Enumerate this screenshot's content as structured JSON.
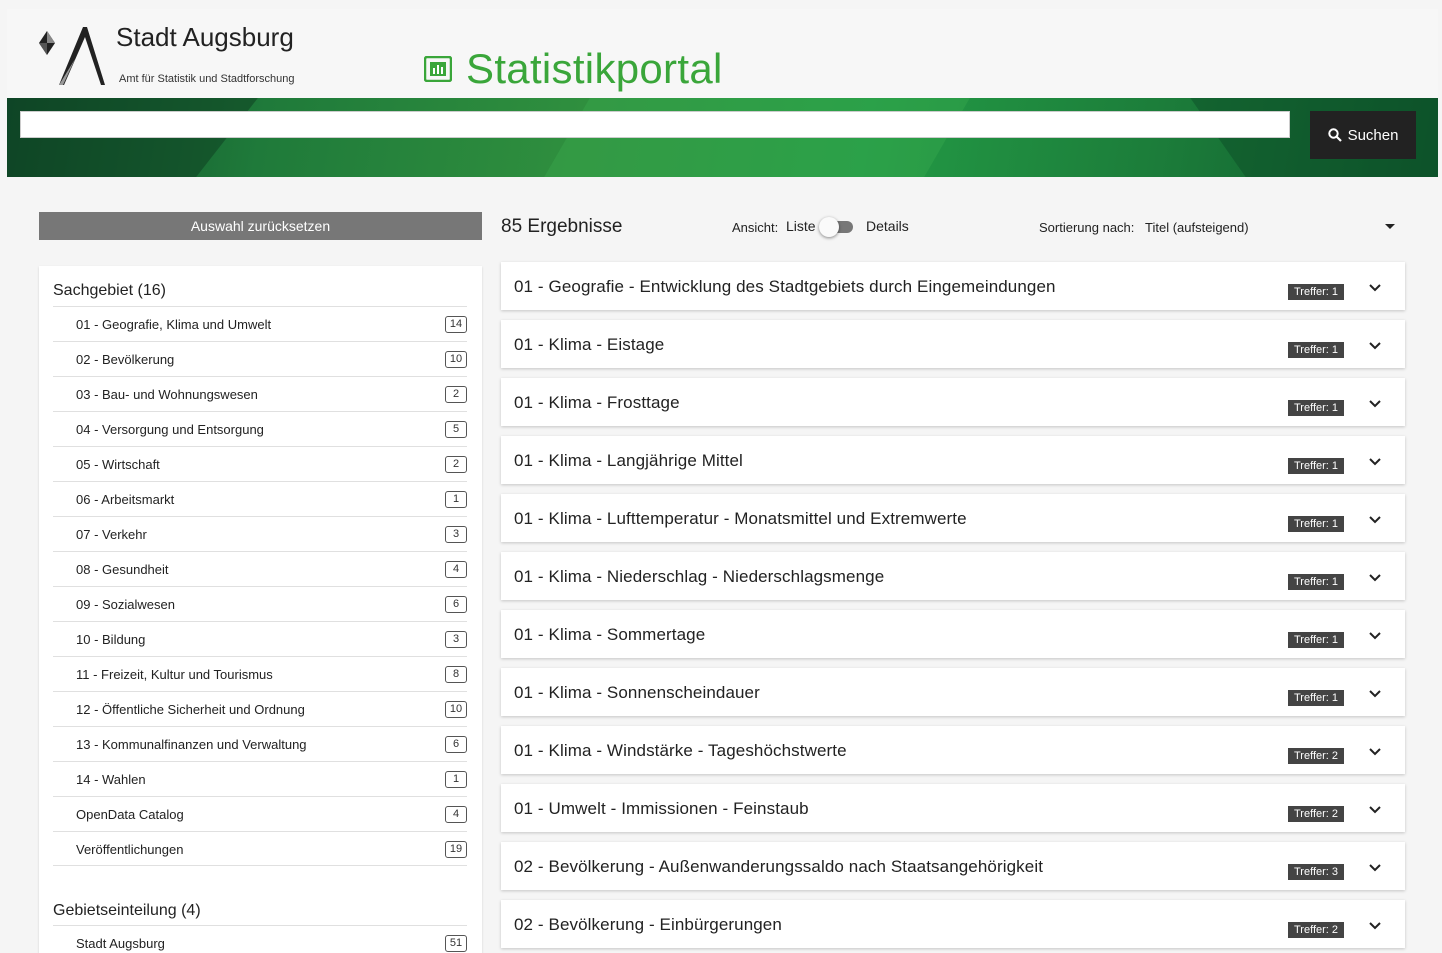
{
  "header": {
    "city_name": "Stadt Augsburg",
    "city_sub": "Amt für Statistik und Stadtforschung",
    "portal_title": "Statistikportal"
  },
  "search": {
    "value": "",
    "placeholder": "",
    "button_label": "Suchen"
  },
  "sidebar": {
    "reset_label": "Auswahl zurücksetzen",
    "groups": [
      {
        "title": "Sachgebiet (16)",
        "items": [
          {
            "label": "01 - Geografie, Klima und Umwelt",
            "count": "14"
          },
          {
            "label": "02 - Bevölkerung",
            "count": "10"
          },
          {
            "label": "03 - Bau- und Wohnungswesen",
            "count": "2"
          },
          {
            "label": "04 - Versorgung und Entsorgung",
            "count": "5"
          },
          {
            "label": "05 - Wirtschaft",
            "count": "2"
          },
          {
            "label": "06 - Arbeitsmarkt",
            "count": "1"
          },
          {
            "label": "07 - Verkehr",
            "count": "3"
          },
          {
            "label": "08 - Gesundheit",
            "count": "4"
          },
          {
            "label": "09 - Sozialwesen",
            "count": "6"
          },
          {
            "label": "10 - Bildung",
            "count": "3"
          },
          {
            "label": "11 - Freizeit, Kultur und Tourismus",
            "count": "8"
          },
          {
            "label": "12 - Öffentliche Sicherheit und Ordnung",
            "count": "10"
          },
          {
            "label": "13 - Kommunalfinanzen und Verwaltung",
            "count": "6"
          },
          {
            "label": "14 - Wahlen",
            "count": "1"
          },
          {
            "label": "OpenData Catalog",
            "count": "4"
          },
          {
            "label": "Veröffentlichungen",
            "count": "19"
          }
        ]
      },
      {
        "title": "Gebietseinteilung (4)",
        "items": [
          {
            "label": "Stadt Augsburg",
            "count": "51"
          }
        ]
      }
    ]
  },
  "results_header": {
    "count_label": "85 Ergebnisse",
    "view_label": "Ansicht:",
    "view_list": "Liste",
    "view_details": "Details",
    "sort_label": "Sortierung nach:",
    "sort_value": "Titel (aufsteigend)"
  },
  "results": [
    {
      "title": "01 - Geografie - Entwicklung des Stadtgebiets durch Eingemeindungen",
      "badge": "Treffer: 1"
    },
    {
      "title": "01 - Klima - Eistage",
      "badge": "Treffer: 1"
    },
    {
      "title": "01 - Klima - Frosttage",
      "badge": "Treffer: 1"
    },
    {
      "title": "01 - Klima - Langjährige Mittel",
      "badge": "Treffer: 1"
    },
    {
      "title": "01 - Klima - Lufttemperatur - Monatsmittel und Extremwerte",
      "badge": "Treffer: 1"
    },
    {
      "title": "01 - Klima - Niederschlag - Niederschlagsmenge",
      "badge": "Treffer: 1"
    },
    {
      "title": "01 - Klima - Sommertage",
      "badge": "Treffer: 1"
    },
    {
      "title": "01 - Klima - Sonnenscheindauer",
      "badge": "Treffer: 1"
    },
    {
      "title": "01 - Klima - Windstärke - Tageshöchstwerte",
      "badge": "Treffer: 2"
    },
    {
      "title": "01 - Umwelt - Immissionen - Feinstaub",
      "badge": "Treffer: 2"
    },
    {
      "title": "02 - Bevölkerung - Außenwanderungssaldo nach Staatsangehörigkeit",
      "badge": "Treffer: 3"
    },
    {
      "title": "02 - Bevölkerung - Einbürgerungen",
      "badge": "Treffer: 2"
    }
  ]
}
